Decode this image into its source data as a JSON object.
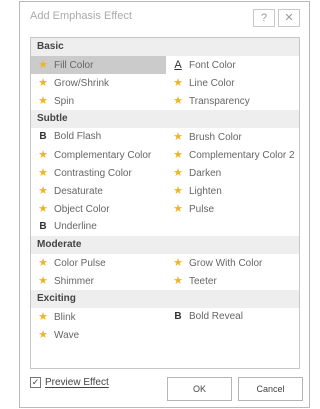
{
  "dialog": {
    "title": "Add Emphasis Effect",
    "help_glyph": "?",
    "close_glyph": "✕"
  },
  "groups": [
    {
      "name": "Basic",
      "items": [
        {
          "label": "Fill Color",
          "icon": "star-icon",
          "selected": true
        },
        {
          "label": "Font Color",
          "icon": "font-color-icon"
        },
        {
          "label": "Grow/Shrink",
          "icon": "star-icon"
        },
        {
          "label": "Line Color",
          "icon": "star-icon"
        },
        {
          "label": "Spin",
          "icon": "star-icon"
        },
        {
          "label": "Transparency",
          "icon": "star-icon"
        }
      ]
    },
    {
      "name": "Subtle",
      "items": [
        {
          "label": "Bold Flash",
          "icon": "bold-icon"
        },
        {
          "label": "Brush Color",
          "icon": "star-icon"
        },
        {
          "label": "Complementary Color",
          "icon": "star-icon"
        },
        {
          "label": "Complementary Color 2",
          "icon": "star-icon"
        },
        {
          "label": "Contrasting Color",
          "icon": "star-icon"
        },
        {
          "label": "Darken",
          "icon": "star-icon"
        },
        {
          "label": "Desaturate",
          "icon": "star-icon"
        },
        {
          "label": "Lighten",
          "icon": "star-icon"
        },
        {
          "label": "Object Color",
          "icon": "star-icon"
        },
        {
          "label": "Pulse",
          "icon": "star-icon"
        },
        {
          "label": "Underline",
          "icon": "bold-icon"
        }
      ]
    },
    {
      "name": "Moderate",
      "items": [
        {
          "label": "Color Pulse",
          "icon": "star-icon"
        },
        {
          "label": "Grow With Color",
          "icon": "star-icon"
        },
        {
          "label": "Shimmer",
          "icon": "star-icon"
        },
        {
          "label": "Teeter",
          "icon": "star-icon"
        }
      ]
    },
    {
      "name": "Exciting",
      "items": [
        {
          "label": "Blink",
          "icon": "star-icon"
        },
        {
          "label": "Bold Reveal",
          "icon": "bold-icon"
        },
        {
          "label": "Wave",
          "icon": "star-icon"
        }
      ]
    }
  ],
  "footer": {
    "preview_label": "Preview Effect",
    "preview_checked": true,
    "ok_label": "OK",
    "cancel_label": "Cancel"
  },
  "colors": {
    "star": "#f0b428",
    "selected_bg": "#cbcbcb",
    "group_header_bg": "#eeeeee"
  }
}
